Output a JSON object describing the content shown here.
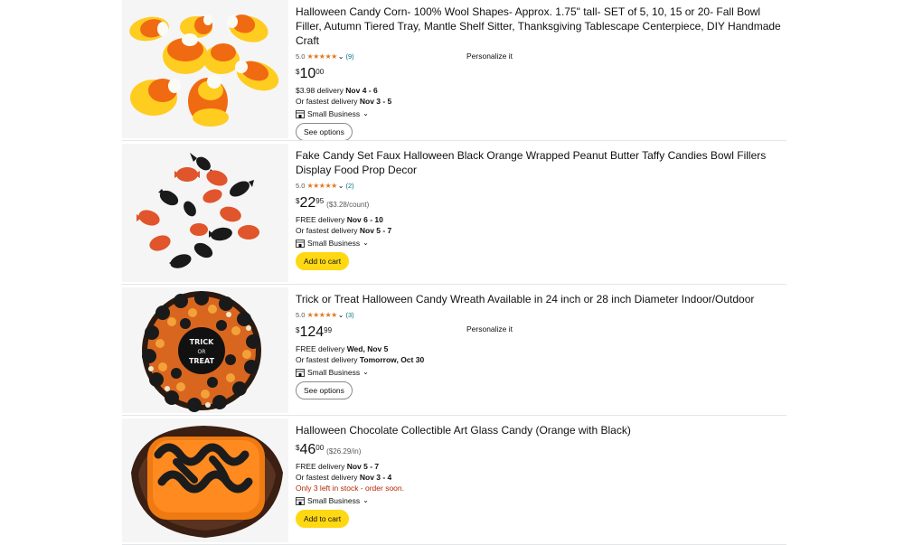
{
  "results": [
    {
      "title": "Halloween Candy Corn- 100% Wool Shapes- Approx. 1.75\" tall- SET of 5, 10, 15 or 20- Fall Bowl Filler, Autumn Tiered Tray, Mantle Shelf Sitter, Thanksgiving Tablescape Centerpiece, DIY Handmade Craft",
      "rating": "5.0",
      "stars": "★★★★★",
      "review_count": "(9)",
      "price_symbol": "$",
      "price_whole": "10",
      "price_fraction": "00",
      "unit_price": "",
      "personalize": "Personalize it",
      "delivery_text": "$3.98 delivery ",
      "delivery_date": "Nov 4 - 6",
      "fastest_text": "Or fastest delivery ",
      "fastest_date": "Nov 3 - 5",
      "stock": "",
      "small_business": "Small Business",
      "button": "See options"
    },
    {
      "title": "Fake Candy Set Faux Halloween Black Orange Wrapped Peanut Butter Taffy Candies Bowl Fillers Display Food Prop Decor",
      "rating": "5.0",
      "stars": "★★★★★",
      "review_count": "(2)",
      "price_symbol": "$",
      "price_whole": "22",
      "price_fraction": "95",
      "unit_price": "($3.28/count)",
      "personalize": "",
      "delivery_text": "FREE delivery ",
      "delivery_date": "Nov 6 - 10",
      "fastest_text": "Or fastest delivery ",
      "fastest_date": "Nov 5 - 7",
      "stock": "",
      "small_business": "Small Business",
      "button": "Add to cart"
    },
    {
      "title": "Trick or Treat Halloween Candy Wreath Available in 24 inch or 28 inch Diameter Indoor/Outdoor",
      "rating": "5.0",
      "stars": "★★★★★",
      "review_count": "(3)",
      "price_symbol": "$",
      "price_whole": "124",
      "price_fraction": "99",
      "unit_price": "",
      "personalize": "Personalize it",
      "delivery_text": "FREE delivery ",
      "delivery_date": "Wed, Nov 5",
      "fastest_text": "Or fastest delivery ",
      "fastest_date": "Tomorrow, Oct 30",
      "stock": "",
      "small_business": "Small Business",
      "button": "See options",
      "image_text_1": "TRICK",
      "image_text_2": "OR",
      "image_text_3": "TREAT"
    },
    {
      "title": "Halloween Chocolate Collectible Art Glass Candy (Orange with Black)",
      "rating": "",
      "stars": "",
      "review_count": "",
      "price_symbol": "$",
      "price_whole": "46",
      "price_fraction": "00",
      "unit_price": "($26.29/in)",
      "personalize": "",
      "delivery_text": "FREE delivery ",
      "delivery_date": "Nov 5 - 7",
      "fastest_text": "Or fastest delivery ",
      "fastest_date": "Nov 3 - 4",
      "stock": "Only 3 left in stock - order soon.",
      "small_business": "Small Business",
      "button": "Add to cart"
    }
  ],
  "icons": {
    "rating_chevron": "chevron-down-icon",
    "small_business": "store-icon",
    "small_business_chevron": "chevron-down-icon"
  },
  "colors": {
    "stars": "#de7921",
    "review_link": "#007185",
    "add_to_cart": "#ffd814",
    "low_stock": "#b12704"
  }
}
